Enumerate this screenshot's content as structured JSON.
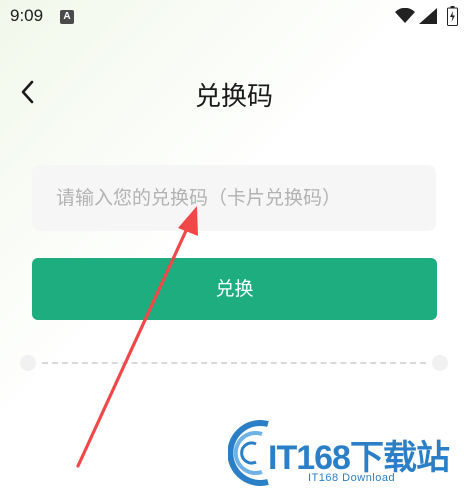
{
  "status_bar": {
    "time": "9:09",
    "notification_badge": "A",
    "icons": [
      "wifi-icon",
      "signal-icon",
      "battery-icon"
    ]
  },
  "header": {
    "back_icon": "chevron-left-icon",
    "title": "兑换码"
  },
  "form": {
    "code_input": {
      "value": "",
      "placeholder": "请输入您的兑换码（卡片兑换码）"
    },
    "submit_label": "兑换"
  },
  "annotation": {
    "arrow_color": "#f04848"
  },
  "watermark": {
    "title": "IT168下载站",
    "subtitle": "IT168 Download",
    "color": "#2a7fc6"
  },
  "colors": {
    "primary": "#1ead7f",
    "input_bg": "#f6f6f6",
    "placeholder": "#b2b2b2"
  }
}
